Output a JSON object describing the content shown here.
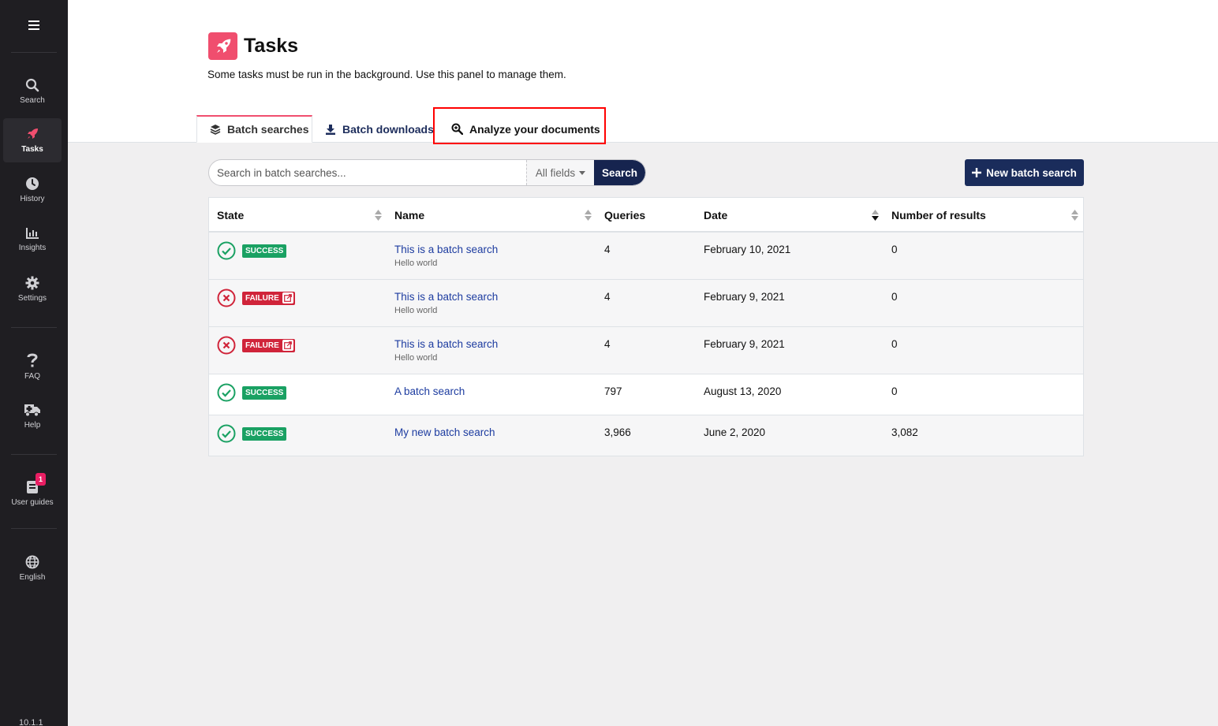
{
  "sidebar": {
    "items": [
      {
        "key": "search",
        "label": "Search",
        "icon": "search-icon"
      },
      {
        "key": "tasks",
        "label": "Tasks",
        "icon": "rocket-icon"
      },
      {
        "key": "history",
        "label": "History",
        "icon": "clock-icon"
      },
      {
        "key": "insights",
        "label": "Insights",
        "icon": "chart-icon"
      },
      {
        "key": "settings",
        "label": "Settings",
        "icon": "gear-icon"
      },
      {
        "key": "faq",
        "label": "FAQ",
        "icon": "question-icon"
      },
      {
        "key": "help",
        "label": "Help",
        "icon": "ambulance-icon"
      },
      {
        "key": "guides",
        "label": "User guides",
        "icon": "book-icon",
        "badge": "1"
      },
      {
        "key": "lang",
        "label": "English",
        "icon": "globe-icon"
      }
    ],
    "version": "10.1.1"
  },
  "header": {
    "title": "Tasks",
    "description": "Some tasks must be run in the background. Use this panel to manage them."
  },
  "tabs": [
    {
      "label": "Batch searches",
      "icon": "layers-icon",
      "active": true
    },
    {
      "label": "Batch downloads",
      "icon": "download-icon",
      "active": false
    },
    {
      "label": "Analyze your documents",
      "icon": "search-plus-icon",
      "active": false
    }
  ],
  "search": {
    "placeholder": "Search in batch searches...",
    "field_select": "All fields",
    "button": "Search"
  },
  "new_button": "New batch search",
  "table": {
    "headers": {
      "state": "State",
      "name": "Name",
      "queries": "Queries",
      "date": "Date",
      "results": "Number of results"
    },
    "rows": [
      {
        "state": "SUCCESS",
        "name": "This is a batch search",
        "description": "Hello world",
        "queries": "4",
        "date": "February 10, 2021",
        "results": "0"
      },
      {
        "state": "FAILURE",
        "name": "This is a batch search",
        "description": "Hello world",
        "queries": "4",
        "date": "February 9, 2021",
        "results": "0"
      },
      {
        "state": "FAILURE",
        "name": "This is a batch search",
        "description": "Hello world",
        "queries": "4",
        "date": "February 9, 2021",
        "results": "0"
      },
      {
        "state": "SUCCESS",
        "name": "A batch search",
        "description": "",
        "queries": "797",
        "date": "August 13, 2020",
        "results": "0"
      },
      {
        "state": "SUCCESS",
        "name": "My new batch search",
        "description": "",
        "queries": "3,966",
        "date": "June 2, 2020",
        "results": "3,082"
      }
    ]
  },
  "colors": {
    "sidebar_bg": "#1f1e22",
    "brand_pink": "#f04e6e",
    "navy": "#1a2c5b",
    "success": "#1aa163",
    "failure": "#d0243a",
    "highlight": "#ff0000"
  }
}
